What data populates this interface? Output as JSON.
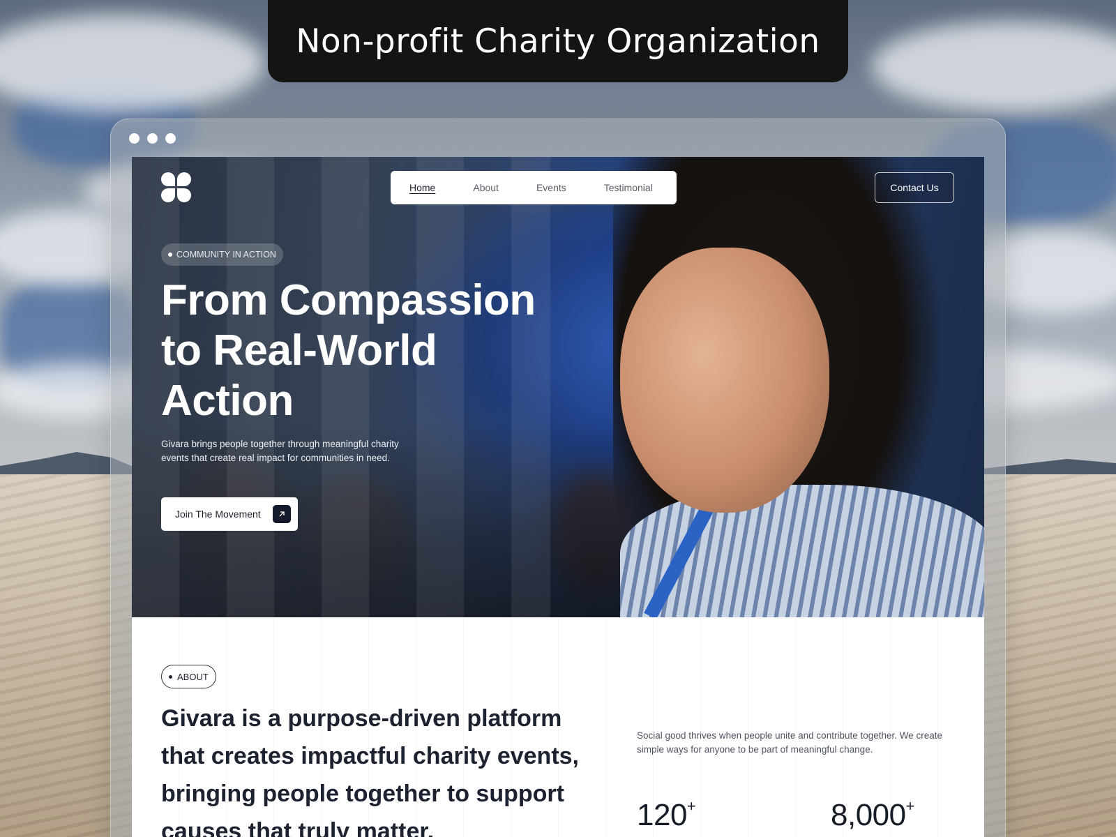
{
  "banner": {
    "title": "Non-profit Charity Organization"
  },
  "browser": {
    "window_controls": [
      "dot",
      "dot",
      "dot"
    ]
  },
  "nav": {
    "items": [
      {
        "label": "Home",
        "active": true
      },
      {
        "label": "About",
        "active": false
      },
      {
        "label": "Events",
        "active": false
      },
      {
        "label": "Testimonial",
        "active": false
      }
    ],
    "contact_label": "Contact Us"
  },
  "hero": {
    "tag": "COMMUNITY IN ACTION",
    "title_line1": "From Compassion",
    "title_line2": "to Real-World",
    "title_line3": "Action",
    "subtitle": "Givara brings people together through meaningful charity events that create real impact for communities in need.",
    "cta_label": "Join The Movement",
    "cta_icon": "arrow-up-right-icon"
  },
  "about": {
    "tag": "ABOUT",
    "heading": "Givara is a purpose-driven platform that creates impactful charity events, bringing people together to support causes that truly matter.",
    "paragraph": "Social good thrives when people unite and contribute together. We create simple ways for anyone to be part of meaningful change.",
    "stats": [
      {
        "value": "120",
        "suffix": "+"
      },
      {
        "value": "8,000",
        "suffix": "+"
      }
    ]
  },
  "colors": {
    "banner_bg": "#141414",
    "hero_text": "#ffffff",
    "dark_accent": "#141a2c",
    "body_text": "#1d2230"
  }
}
